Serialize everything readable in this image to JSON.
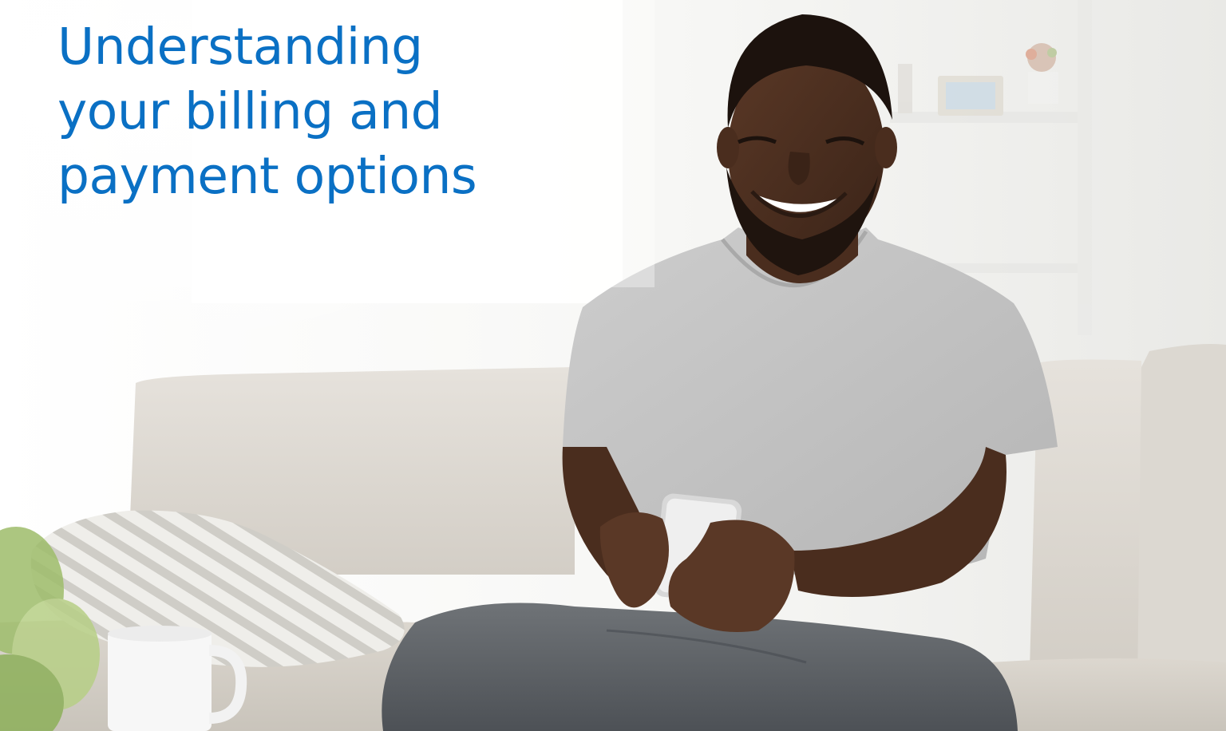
{
  "hero": {
    "headline_lines": [
      "Understanding",
      "your billing and",
      "payment options"
    ]
  },
  "colors": {
    "headline": "#0a70c4",
    "background": "#f3f3f1"
  },
  "image": {
    "subject": "man-smiling-using-smartphone-on-sofa"
  }
}
